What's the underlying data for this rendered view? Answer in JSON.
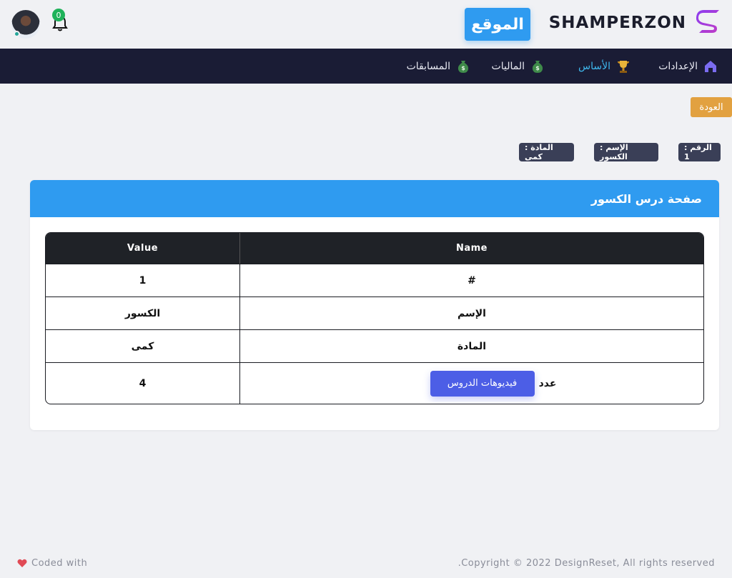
{
  "header": {
    "brand_name": "SHAMPERZON",
    "site_button": "الموقع",
    "notifications_count": "0"
  },
  "nav": {
    "items": [
      {
        "label": "الإعدادات",
        "icon": "home-icon",
        "active": false
      },
      {
        "label": "الأساس",
        "icon": "trophy-icon",
        "active": true
      },
      {
        "label": "الماليات",
        "icon": "money-bag-icon",
        "active": false
      },
      {
        "label": "المسابقات",
        "icon": "money-bag-icon",
        "active": false
      }
    ]
  },
  "back_button": "العودة",
  "chips": {
    "number": "الرقم : 1",
    "name": "الإسم : الكسور",
    "subject": "المادة : كمى"
  },
  "card": {
    "title": "صفحة درس الكسور",
    "table": {
      "headers": {
        "value": "Value",
        "name": "Name"
      },
      "rows": [
        {
          "name": "#",
          "value": "1"
        },
        {
          "name": "الإسم",
          "value": "الكسور"
        },
        {
          "name": "المادة",
          "value": "كمى"
        },
        {
          "name": "عدد",
          "value": "4",
          "button": "فيديوهات الدروس"
        }
      ]
    }
  },
  "footer": {
    "left": "Coded with",
    "right": ".Copyright © 2022 DesignReset, All rights reserved"
  },
  "colors": {
    "navbar": "#1a1c35",
    "primary": "#2f9bf0",
    "back_button": "#e2a140",
    "videos_button": "#4c5ee6",
    "active_nav": "#3fb9ef"
  }
}
